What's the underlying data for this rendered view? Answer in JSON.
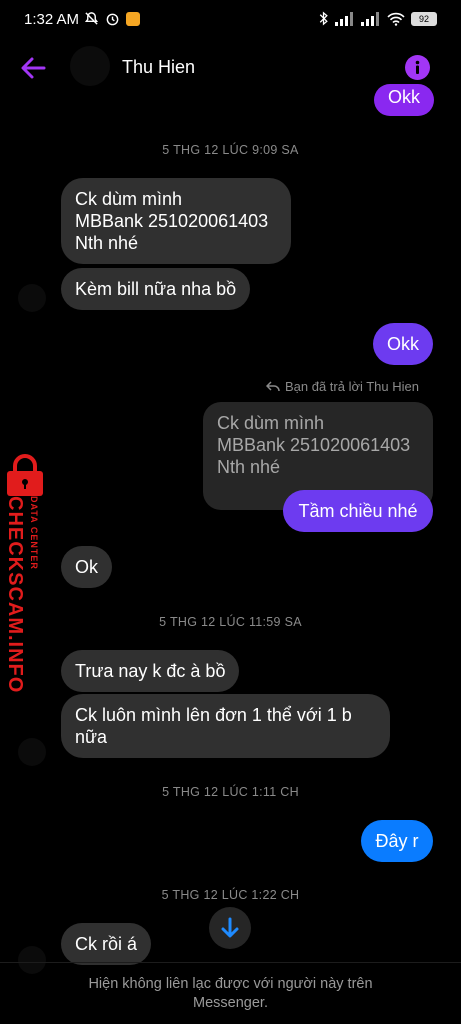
{
  "status_bar": {
    "time": "1:32 AM",
    "battery": "92"
  },
  "header": {
    "title": "Thu Hien"
  },
  "messages": {
    "top_partial": "Okk",
    "ts1": "5 THG 12 LÚC 9:09 SA",
    "in1_line1": "Ck dùm mình",
    "in1_line2": "MBBank 251020061403",
    "in1_line3": "Nth nhé",
    "in2": "Kèm bill nữa nha bồ",
    "out1": "Okk",
    "reply_note": "Bạn đã trả lời Thu Hien",
    "quote_line1": "Ck dùm mình",
    "quote_line2": "MBBank 251020061403",
    "quote_line3": "Nth nhé",
    "out2": "Tầm chiều nhé",
    "in3": "Ok",
    "ts2": "5 THG 12 LÚC 11:59 SA",
    "in4": "Trưa nay k đc à bồ",
    "in5_line1": "Ck luôn mình lên đơn 1 thể với 1 b",
    "in5_line2": "nữa",
    "ts3": "5 THG 12 LÚC 1:11 CH",
    "out3": "Đây r",
    "ts4": "5 THG 12 LÚC 1:22 CH",
    "in6": "Ck rồi á"
  },
  "watermark": {
    "main": "CHECKSCAM.INFO",
    "sub": "DATA CENTER"
  },
  "footer": {
    "line1": "Hiện không liên lạc được với người này trên",
    "line2": "Messenger."
  },
  "colors": {
    "accent": "#a236f5",
    "incoming_bubble": "#303030",
    "outgoing_purple": "#6d3bf0",
    "outgoing_magenta": "#8a28f0",
    "outgoing_blue": "#0a7cff",
    "watermark": "#e11c1c"
  },
  "icons": [
    "back-arrow-icon",
    "info-icon",
    "reply-icon",
    "arrow-down-icon",
    "wifi-icon",
    "signal-icon",
    "bluetooth-icon",
    "alarm-icon",
    "mute-bell-icon"
  ]
}
